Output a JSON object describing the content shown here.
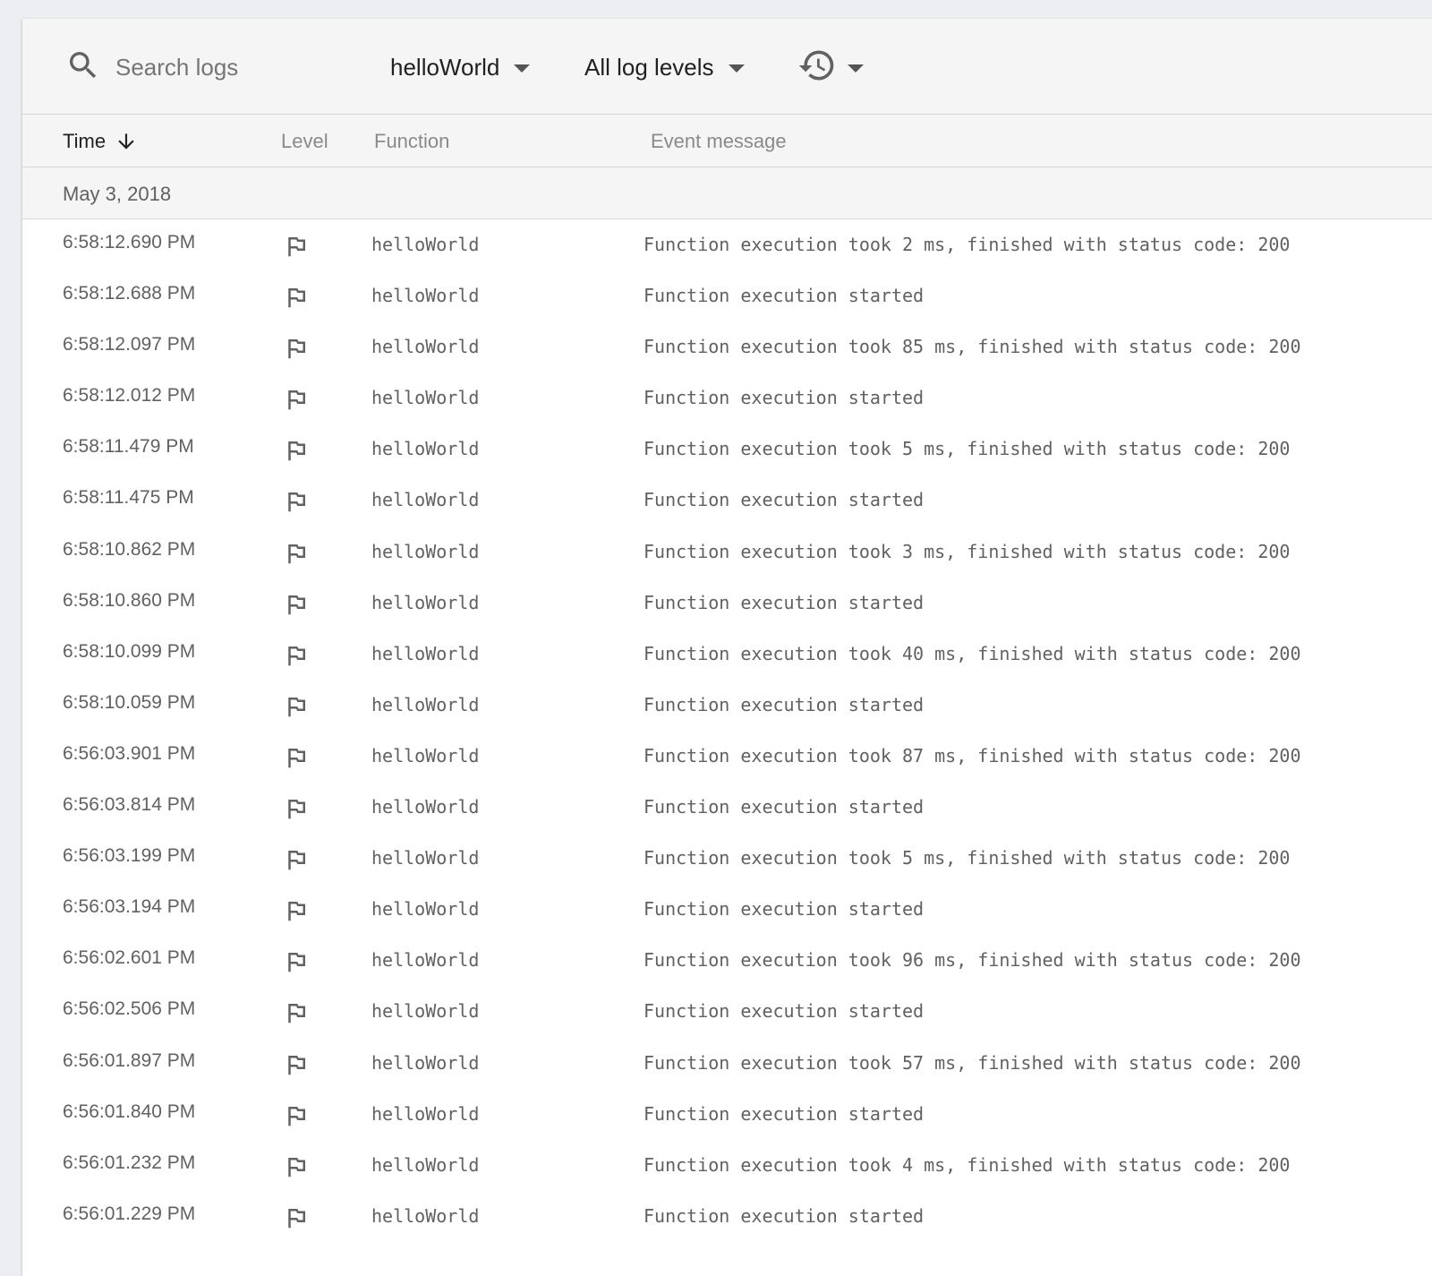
{
  "toolbar": {
    "search_placeholder": "Search logs",
    "function_filter": "helloWorld",
    "level_filter": "All log levels",
    "history_icon": "history-icon"
  },
  "columns": {
    "time": "Time",
    "level": "Level",
    "function": "Function",
    "event": "Event message"
  },
  "date_group": "May 3, 2018",
  "rows": [
    {
      "time": "6:58:12.690 PM",
      "function": "helloWorld",
      "message": "Function execution took 2 ms, finished with status code: 200"
    },
    {
      "time": "6:58:12.688 PM",
      "function": "helloWorld",
      "message": "Function execution started"
    },
    {
      "time": "6:58:12.097 PM",
      "function": "helloWorld",
      "message": "Function execution took 85 ms, finished with status code: 200"
    },
    {
      "time": "6:58:12.012 PM",
      "function": "helloWorld",
      "message": "Function execution started"
    },
    {
      "time": "6:58:11.479 PM",
      "function": "helloWorld",
      "message": "Function execution took 5 ms, finished with status code: 200"
    },
    {
      "time": "6:58:11.475 PM",
      "function": "helloWorld",
      "message": "Function execution started"
    },
    {
      "time": "6:58:10.862 PM",
      "function": "helloWorld",
      "message": "Function execution took 3 ms, finished with status code: 200"
    },
    {
      "time": "6:58:10.860 PM",
      "function": "helloWorld",
      "message": "Function execution started"
    },
    {
      "time": "6:58:10.099 PM",
      "function": "helloWorld",
      "message": "Function execution took 40 ms, finished with status code: 200"
    },
    {
      "time": "6:58:10.059 PM",
      "function": "helloWorld",
      "message": "Function execution started"
    },
    {
      "time": "6:56:03.901 PM",
      "function": "helloWorld",
      "message": "Function execution took 87 ms, finished with status code: 200"
    },
    {
      "time": "6:56:03.814 PM",
      "function": "helloWorld",
      "message": "Function execution started"
    },
    {
      "time": "6:56:03.199 PM",
      "function": "helloWorld",
      "message": "Function execution took 5 ms, finished with status code: 200"
    },
    {
      "time": "6:56:03.194 PM",
      "function": "helloWorld",
      "message": "Function execution started"
    },
    {
      "time": "6:56:02.601 PM",
      "function": "helloWorld",
      "message": "Function execution took 96 ms, finished with status code: 200"
    },
    {
      "time": "6:56:02.506 PM",
      "function": "helloWorld",
      "message": "Function execution started"
    },
    {
      "time": "6:56:01.897 PM",
      "function": "helloWorld",
      "message": "Function execution took 57 ms, finished with status code: 200"
    },
    {
      "time": "6:56:01.840 PM",
      "function": "helloWorld",
      "message": "Function execution started"
    },
    {
      "time": "6:56:01.232 PM",
      "function": "helloWorld",
      "message": "Function execution took 4 ms, finished with status code: 200"
    },
    {
      "time": "6:56:01.229 PM",
      "function": "helloWorld",
      "message": "Function execution started"
    }
  ]
}
